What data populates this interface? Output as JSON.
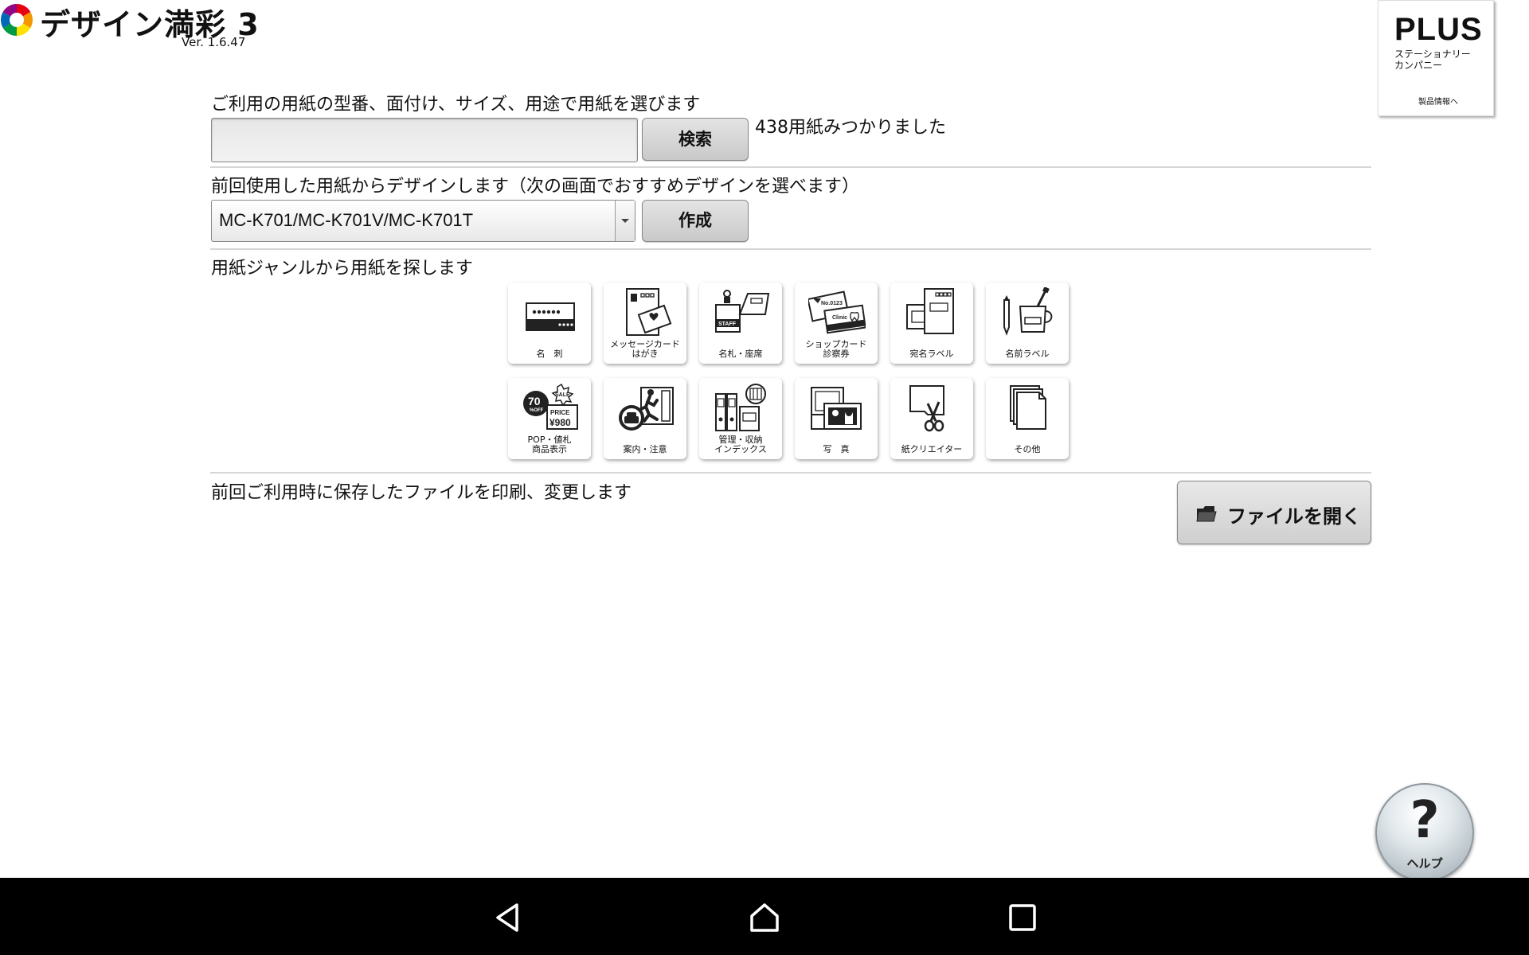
{
  "header": {
    "app_title": "デザイン満彩 3",
    "version": "Ver. 1.6.47"
  },
  "brand_card": {
    "name": "PLUS",
    "subtitle": "ステーショナリー\nカンパニー",
    "link": "製品情報へ"
  },
  "search": {
    "label": "ご利用の用紙の型番、面付け、サイズ、用途で用紙を選びます",
    "placeholder": "",
    "button": "検索",
    "result": "438用紙みつかりました"
  },
  "previous": {
    "label": "前回使用した用紙からデザインします（次の画面でおすすめデザインを選べます）",
    "selected": "MC-K701/MC-K701V/MC-K701T",
    "button": "作成"
  },
  "genre": {
    "label": "用紙ジャンルから用紙を探します",
    "items": [
      {
        "label": "名　刺",
        "icon": "business-card-icon"
      },
      {
        "label": "メッセージカード\nはがき",
        "icon": "message-card-icon"
      },
      {
        "label": "名札・座席",
        "icon": "name-tag-icon"
      },
      {
        "label": "ショップカード\n診察券",
        "icon": "shop-card-icon"
      },
      {
        "label": "宛名ラベル",
        "icon": "address-label-icon"
      },
      {
        "label": "名前ラベル",
        "icon": "name-label-icon"
      },
      {
        "label": "POP・値札\n商品表示",
        "icon": "pop-sale-icon"
      },
      {
        "label": "案内・注意",
        "icon": "guide-sign-icon"
      },
      {
        "label": "管理・収納\nインデックス",
        "icon": "binder-index-icon"
      },
      {
        "label": "写　真",
        "icon": "photo-icon"
      },
      {
        "label": "紙クリエイター",
        "icon": "scissors-icon"
      },
      {
        "label": "その他",
        "icon": "other-pages-icon"
      }
    ]
  },
  "saved_file": {
    "label": "前回ご利用時に保存したファイルを印刷、変更します",
    "button": "ファイルを開く"
  },
  "help": {
    "symbol": "?",
    "label": "ヘルプ"
  }
}
